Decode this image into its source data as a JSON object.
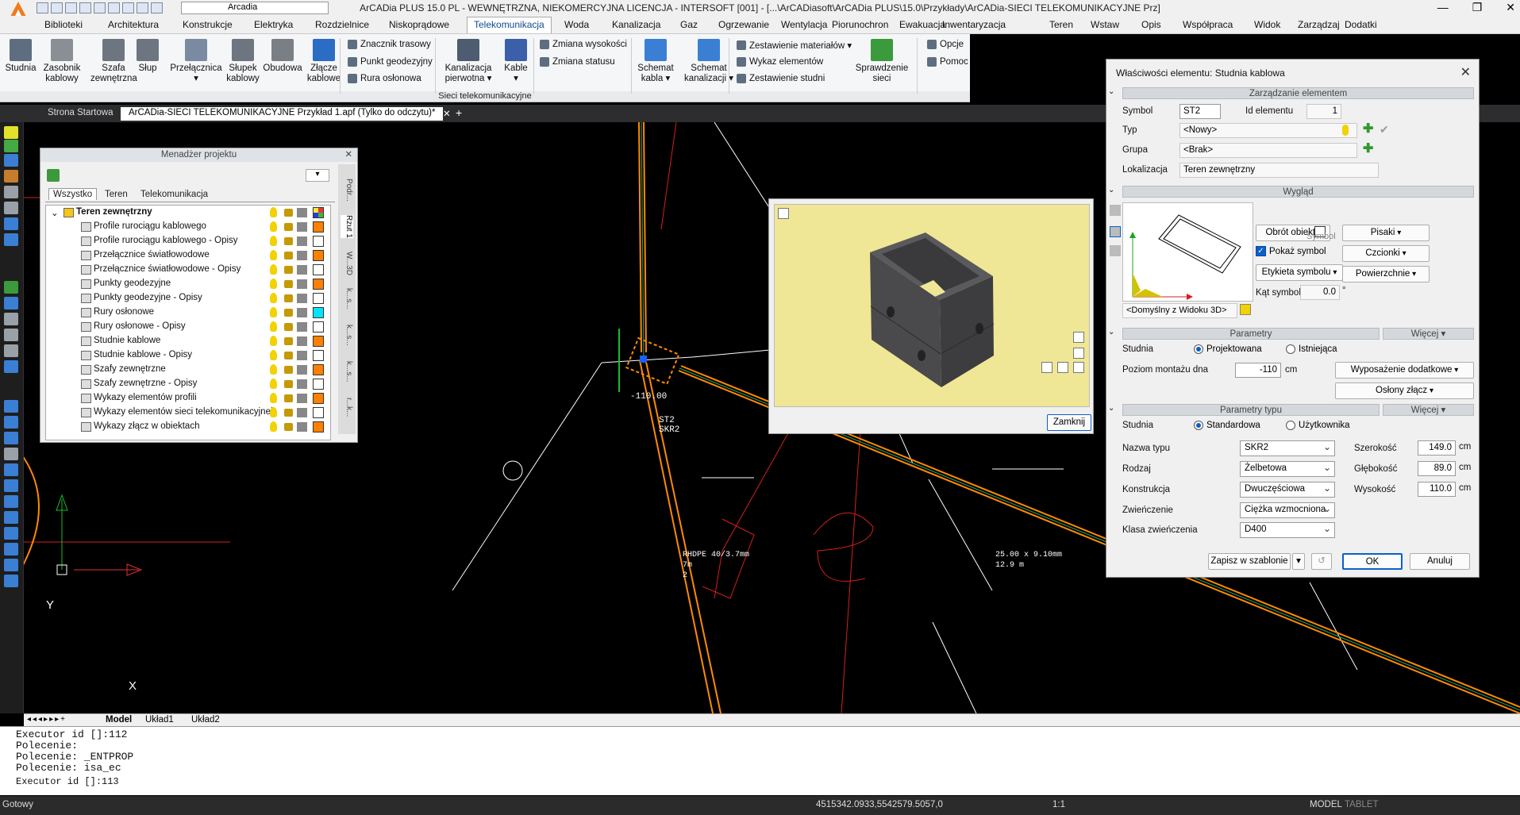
{
  "window": {
    "title": "ArCADia PLUS 15.0 PL - WEWNĘTRZNA, NIEKOMERCYJNA LICENCJA - INTERSOFT [001] - [...\\ArCADiasoft\\ArCADia PLUS\\15.0\\Przykłady\\ArCADia-SIECI TELEKOMUNIKACYJNE Prz]",
    "workspace_combo": "Arcadia"
  },
  "menu": [
    "Biblioteki",
    "Architektura",
    "Konstrukcje",
    "Elektryka",
    "Rozdzielnice",
    "Niskoprądowe",
    "Telekomunikacja",
    "Woda",
    "Kanalizacja",
    "Gaz",
    "Ogrzewanie",
    "Wentylacja",
    "Piorunochron",
    "Ewakuacja",
    "Inwentaryzacja",
    "Teren",
    "Wstaw",
    "Opis",
    "Współpraca",
    "Widok",
    "Zarządzaj",
    "Dodatki"
  ],
  "menu_active": "Telekomunikacja",
  "ribbon": {
    "big": [
      {
        "label": "Studnia",
        "sub": ""
      },
      {
        "label": "Zasobnik",
        "sub": "kablowy"
      },
      {
        "label": "Szafa",
        "sub": "zewnętrzna"
      },
      {
        "label": "Słup",
        "sub": ""
      },
      {
        "label": "Przełącznica",
        "sub": "▾"
      },
      {
        "label": "Słupek",
        "sub": "kablowy"
      },
      {
        "label": "Obudowa",
        "sub": ""
      },
      {
        "label": "Złącze",
        "sub": "kablowe"
      },
      {
        "label": "Kanalizacja",
        "sub": "pierwotna ▾"
      },
      {
        "label": "Kable",
        "sub": "▾"
      },
      {
        "label": "Schemat",
        "sub": "kabla ▾"
      },
      {
        "label": "Schemat",
        "sub": "kanalizacji ▾"
      },
      {
        "label": "Sprawdzenie",
        "sub": "sieci"
      }
    ],
    "small": [
      "Znacznik trasowy",
      "Punkt geodezyjny",
      "Rura osłonowa",
      "Zmiana wysokości",
      "Zmiana statusu",
      "Zestawienie materiałów ▾",
      "Wykaz elementów",
      "Zestawienie studni",
      "Opcje",
      "Pomoc"
    ],
    "group_label": "Sieci telekomunikacyjne"
  },
  "doc_tabs": [
    "Strona Startowa",
    "ArCADia-SIECI TELEKOMUNIKACYJNE Przykład 1.apf (Tylko do odczytu)*"
  ],
  "project_manager": {
    "title": "Menadżer projektu",
    "tabs": [
      "Wszystko",
      "Teren",
      "Telekomunikacja"
    ],
    "root": "Teren zewnętrzny",
    "items": [
      {
        "label": "Profile rurociągu kablowego",
        "color": "#ff8000"
      },
      {
        "label": "Profile rurociągu kablowego - Opisy",
        "color": "#ffffff"
      },
      {
        "label": "Przełącznice światłowodowe",
        "color": "#ff8000"
      },
      {
        "label": "Przełącznice światłowodowe - Opisy",
        "color": "#ffffff"
      },
      {
        "label": "Punkty geodezyjne",
        "color": "#ff8000"
      },
      {
        "label": "Punkty geodezyjne - Opisy",
        "color": "#ffffff"
      },
      {
        "label": "Rury osłonowe",
        "color": "#00e5ff"
      },
      {
        "label": "Rury osłonowe - Opisy",
        "color": "#ffffff"
      },
      {
        "label": "Studnie kablowe",
        "color": "#ff8000"
      },
      {
        "label": "Studnie kablowe - Opisy",
        "color": "#ffffff"
      },
      {
        "label": "Szafy zewnętrzne",
        "color": "#ff8000"
      },
      {
        "label": "Szafy zewnętrzne - Opisy",
        "color": "#ffffff"
      },
      {
        "label": "Wykazy elementów profili",
        "color": "#ff8000"
      },
      {
        "label": "Wykazy elementów sieci telekomunikacyjnej",
        "color": "#ffffff"
      },
      {
        "label": "Wykazy złącz w obiektach",
        "color": "#ff8000"
      }
    ],
    "side_tabs": [
      "Podr...",
      "Rzut 1",
      "W...3D",
      "k...s...",
      "k...s...",
      "k...s...",
      "r...k..."
    ]
  },
  "preview": {
    "close_label": "Zamknij"
  },
  "dialog": {
    "title": "Właściwości elementu: Studnia kablowa",
    "sec_manage": "Zarządzanie elementem",
    "symbol_label": "Symbol",
    "symbol_value": "ST2",
    "id_label": "Id elementu",
    "id_value": "1",
    "type_label": "Typ",
    "type_value": "<Nowy>",
    "group_label": "Grupa",
    "group_value": "<Brak>",
    "loc_label": "Lokalizacja",
    "loc_value": "Teren zewnętrzny",
    "sec_look": "Wygląd",
    "rotate_btn": "Obrót obiektu",
    "pens_btn": "Pisaki",
    "fonts_btn": "Czcionki",
    "surfaces_btn": "Powierzchnie",
    "symbol_group": "Symbol",
    "show_symbol": "Pokaż symbol",
    "symbol_label_btn": "Etykieta symbolu",
    "angle_label": "Kąt symbolu",
    "angle_value": "0.0",
    "angle_unit": "°",
    "view_combo": "<Domyślny z Widoku 3D>",
    "sec_params": "Parametry",
    "more1": "Więcej",
    "well_label": "Studnia",
    "r_designed": "Projektowana",
    "r_existing": "Istniejąca",
    "level_label": "Poziom montażu dna",
    "level_value": "-110",
    "level_unit": "cm",
    "equip_btn": "Wyposażenie dodatkowe",
    "covers_btn": "Osłony złącz",
    "sec_typeparams": "Parametry typu",
    "more2": "Więcej",
    "well2_label": "Studnia",
    "r_standard": "Standardowa",
    "r_user": "Użytkownika",
    "typename_label": "Nazwa typu",
    "typename_value": "SKR2",
    "kind_label": "Rodzaj",
    "kind_value": "Żelbetowa",
    "constr_label": "Konstrukcja",
    "constr_value": "Dwuczęściowa",
    "finish_label": "Zwieńczenie",
    "finish_value": "Ciężka wzmocniona",
    "class_label": "Klasa zwieńczenia",
    "class_value": "D400",
    "width_label": "Szerokość",
    "width_value": "149.0",
    "depth_label": "Głębokość",
    "depth_value": "89.0",
    "height_label": "Wysokość",
    "height_value": "110.0",
    "unit_cm": "cm",
    "save_tpl": "Zapisz w szablonie",
    "ok": "OK",
    "cancel": "Anuluj"
  },
  "canvas_labels": {
    "level": "-110.00",
    "st2": "ST2",
    "skr2": "SKR2",
    "rhdpe1": "RHDPE 40/3.7mm",
    "rhdpe2": "7m",
    "rhdpe3": "2",
    "pipe1": "25.00 x 9.10mm",
    "pipe2": "12.9 m",
    "axis_y": "Y",
    "axis_x": "X"
  },
  "layout_tabs": [
    "Model",
    "Układ1",
    "Układ2"
  ],
  "command_lines": [
    "Executor id []:112",
    "Polecenie:",
    "Polecenie: _ENTPROP",
    "Polecenie: isa_ec",
    "Executor id []:113"
  ],
  "status": {
    "left": "Gotowy",
    "coords": "4515342.0933,5542579.5057,0",
    "scale": "1:1",
    "model": "MODEL",
    "tablet": "TABLET"
  }
}
